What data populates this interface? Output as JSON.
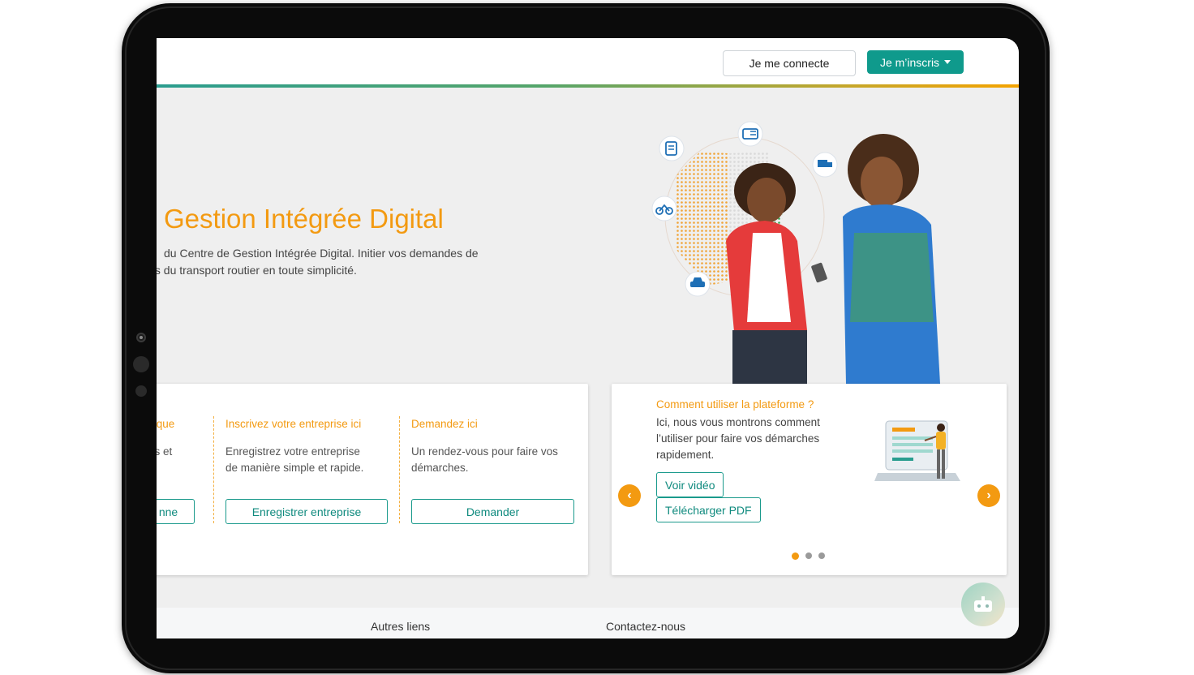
{
  "header": {
    "login_label": "Je me connecte",
    "signup_label": "Je m’inscris"
  },
  "hero": {
    "title": "Gestion Intégrée Digital",
    "subtitle_line1": "du Centre de Gestion Intégrée Digital. Initier vos demandes de",
    "subtitle_line2": "fs du transport routier en toute simplicité."
  },
  "services": [
    {
      "title": "sique",
      "desc_line1": "es et",
      "desc_line2": "",
      "button": "nne"
    },
    {
      "title": "Inscrivez votre entreprise ici",
      "desc_line1": "Enregistrez votre entreprise",
      "desc_line2": "de manière simple et rapide.",
      "button": "Enregistrer entreprise"
    },
    {
      "title": "Demandez ici",
      "desc_line1": "Un rendez-vous pour faire vos",
      "desc_line2": "démarches.",
      "button": "Demander"
    }
  ],
  "tutorial": {
    "title": "Comment utiliser la plateforme ?",
    "text": "Ici, nous vous montrons comment l’utiliser pour faire vos démarches rapidement.",
    "video_button": "Voir vidéo",
    "pdf_button": "Télécharger PDF",
    "prev_glyph": "‹",
    "next_glyph": "›",
    "slide_count": 3,
    "active_slide": 1
  },
  "footer": {
    "links": [
      "Autres liens",
      "Contactez-nous"
    ]
  },
  "colors": {
    "accent_orange": "#f39a11",
    "brand_teal": "#0f9a8c"
  }
}
